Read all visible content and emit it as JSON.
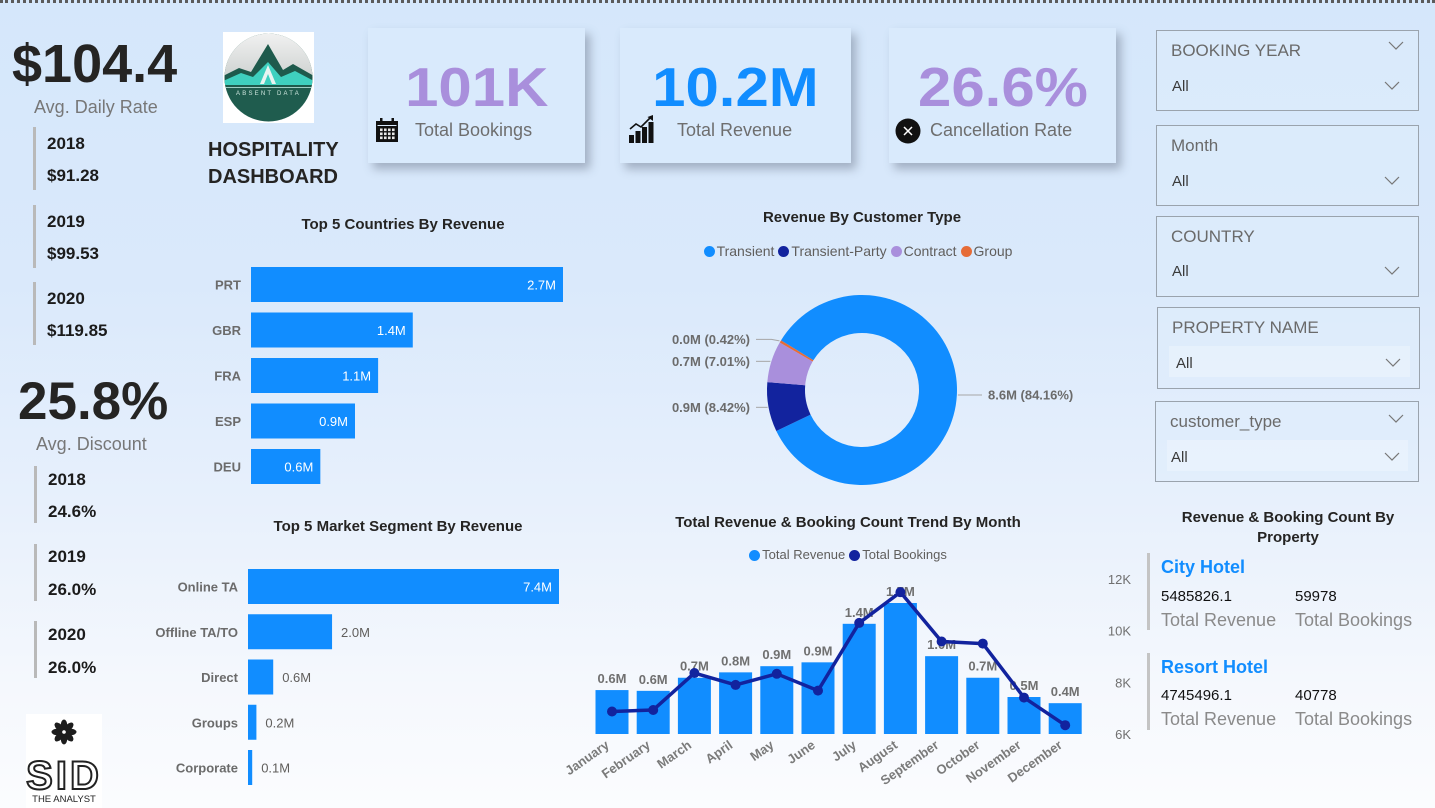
{
  "header": {
    "title_line1": "HOSPITALITY",
    "title_line2": "DASHBOARD",
    "logo_text": "ABSENT DATA"
  },
  "adr": {
    "value": "$104.4",
    "label": "Avg. Daily Rate",
    "years": [
      {
        "year": "2018",
        "value": "$91.28"
      },
      {
        "year": "2019",
        "value": "$99.53"
      },
      {
        "year": "2020",
        "value": "$119.85"
      }
    ]
  },
  "discount": {
    "value": "25.8%",
    "label": "Avg. Discount",
    "years": [
      {
        "year": "2018",
        "value": "24.6%"
      },
      {
        "year": "2019",
        "value": "26.0%"
      },
      {
        "year": "2020",
        "value": "26.0%"
      }
    ]
  },
  "kpis": [
    {
      "value": "101K",
      "label": "Total Bookings",
      "icon": "calendar-icon",
      "color": "#a98fdc"
    },
    {
      "value": "10.2M",
      "label": "Total Revenue",
      "icon": "revenue-growth-chart-icon",
      "color": "#118dff"
    },
    {
      "value": "26.6%",
      "label": "Cancellation Rate",
      "icon": "cancel-circle-icon",
      "color": "#a98fdc"
    }
  ],
  "slicers": [
    {
      "title": "BOOKING YEAR",
      "value": "All"
    },
    {
      "title": "Month",
      "value": "All"
    },
    {
      "title": "COUNTRY",
      "value": "All"
    },
    {
      "title": "PROPERTY NAME",
      "value": "All"
    },
    {
      "title": "customer_type",
      "value": "All"
    }
  ],
  "property": {
    "title": "Revenue & Booking Count By Property",
    "hotels": [
      {
        "name": "City Hotel",
        "revenue": "5485826.1",
        "bookings": "59978",
        "revenue_label": "Total Revenue",
        "bookings_label": "Total Bookings"
      },
      {
        "name": "Resort Hotel",
        "revenue": "4745496.1",
        "bookings": "40778",
        "revenue_label": "Total Revenue",
        "bookings_label": "Total Bookings"
      }
    ]
  },
  "branding": {
    "name": "SID",
    "tagline": "THE ANALYST"
  },
  "chart_data": [
    {
      "id": "top_countries",
      "type": "bar",
      "orientation": "horizontal",
      "title": "Top 5 Countries By Revenue",
      "categories": [
        "PRT",
        "GBR",
        "FRA",
        "ESP",
        "DEU"
      ],
      "values": [
        2.7,
        1.4,
        1.1,
        0.9,
        0.6
      ],
      "value_labels": [
        "2.7M",
        "1.4M",
        "1.1M",
        "0.9M",
        "0.6M"
      ],
      "unit": "M",
      "xlabel": "",
      "ylabel": "",
      "color": "#118dff"
    },
    {
      "id": "top_market_segments",
      "type": "bar",
      "orientation": "horizontal",
      "title": "Top 5 Market Segment By Revenue",
      "categories": [
        "Online TA",
        "Offline TA/TO",
        "Direct",
        "Groups",
        "Corporate"
      ],
      "values": [
        7.4,
        2.0,
        0.6,
        0.2,
        0.1
      ],
      "value_labels": [
        "7.4M",
        "2.0M",
        "0.6M",
        "0.2M",
        "0.1M"
      ],
      "unit": "M",
      "xlabel": "",
      "ylabel": "",
      "color": "#118dff"
    },
    {
      "id": "revenue_by_customer_type",
      "type": "pie",
      "donut": true,
      "title": "Revenue By Customer Type",
      "legend": "top",
      "categories": [
        "Transient",
        "Transient-Party",
        "Contract",
        "Group"
      ],
      "values": [
        8.6,
        0.9,
        0.7,
        0.04
      ],
      "percentages": [
        84.16,
        8.42,
        7.01,
        0.42
      ],
      "value_labels": [
        "8.6M (84.16%)",
        "0.9M (8.42%)",
        "0.7M (7.01%)",
        "0.0M (0.42%)"
      ],
      "colors": [
        "#118dff",
        "#12239e",
        "#a98fdc",
        "#e66c37"
      ]
    },
    {
      "id": "monthly_trend",
      "type": "bar",
      "combo": "bar+line",
      "title": "Total Revenue & Booking Count Trend By Month",
      "legend": "top",
      "categories": [
        "January",
        "February",
        "March",
        "April",
        "May",
        "June",
        "July",
        "August",
        "September",
        "October",
        "November",
        "December"
      ],
      "series": [
        {
          "name": "Total Revenue",
          "type": "bar",
          "unit": "M",
          "values": [
            0.57,
            0.56,
            0.73,
            0.8,
            0.88,
            0.93,
            1.43,
            1.7,
            1.01,
            0.73,
            0.48,
            0.4
          ],
          "value_labels": [
            "0.6M",
            "0.6M",
            "0.7M",
            "0.8M",
            "0.9M",
            "0.9M",
            "1.4M",
            "1.7M",
            "1.0M",
            "0.7M",
            "0.5M",
            "0.4M"
          ],
          "color": "#118dff"
        },
        {
          "name": "Total Bookings",
          "type": "line",
          "unit": "K",
          "axis": "right",
          "values": [
            6.87,
            6.93,
            8.36,
            7.9,
            8.33,
            7.68,
            10.3,
            11.49,
            9.58,
            9.5,
            7.41,
            6.34
          ],
          "color": "#12239e"
        }
      ],
      "y2_ticks": [
        "6K",
        "8K",
        "10K",
        "12K"
      ],
      "y2_tick_values": [
        6,
        8,
        10,
        12
      ],
      "y2lim": [
        6,
        12
      ],
      "xlabel": "",
      "ylabel": ""
    }
  ]
}
